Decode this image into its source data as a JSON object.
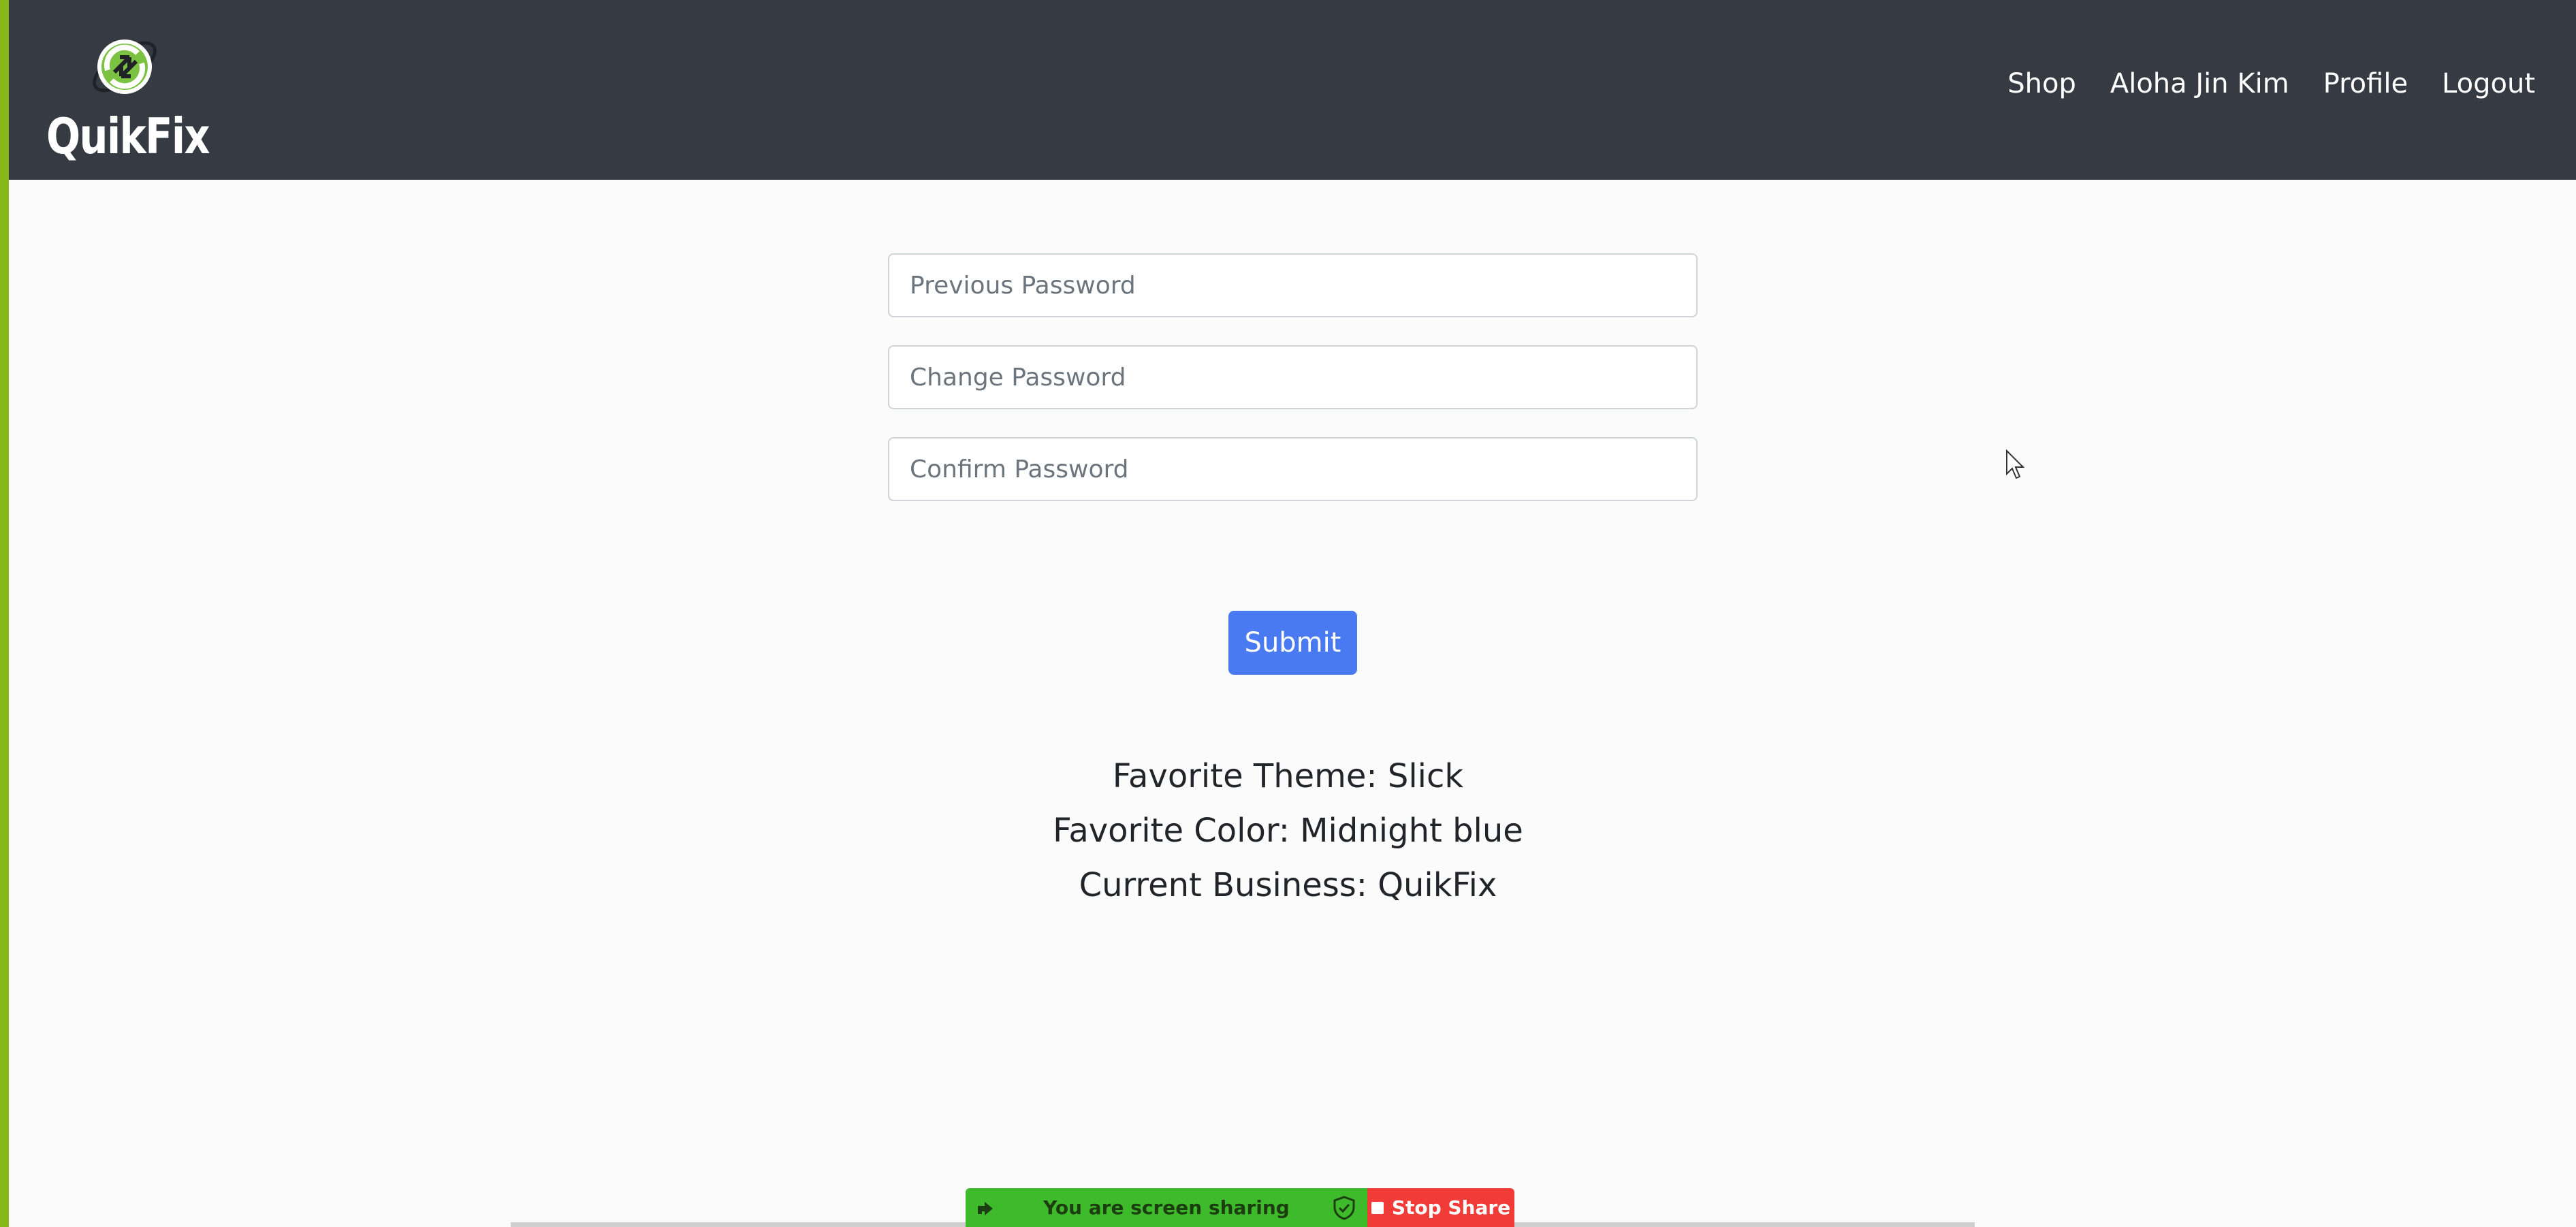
{
  "brand": {
    "name": "QuikFix"
  },
  "nav": {
    "links": [
      {
        "label": "Shop"
      },
      {
        "label": "Aloha Jin Kim"
      },
      {
        "label": "Profile"
      },
      {
        "label": "Logout"
      }
    ]
  },
  "form": {
    "previous_password_placeholder": "Previous Password",
    "change_password_placeholder": "Change Password",
    "confirm_password_placeholder": "Confirm Password",
    "submit_label": "Submit"
  },
  "profile_info": {
    "favorite_theme": "Favorite Theme: Slick",
    "favorite_color": "Favorite Color: Midnight blue",
    "current_business": "Current Business: QuikFix"
  },
  "screen_share": {
    "status": "You are screen sharing",
    "stop_label": "Stop Share"
  },
  "colors": {
    "navbar": "#363a42",
    "accent_bar": "#86b817",
    "submit": "#4a7af2",
    "share_green": "#3dbb2a",
    "share_red": "#f03b36"
  },
  "icons": [
    "refresh-logo-icon",
    "mouse-cursor-icon",
    "share-arrow-icon",
    "shield-icon",
    "stop-square-icon"
  ]
}
